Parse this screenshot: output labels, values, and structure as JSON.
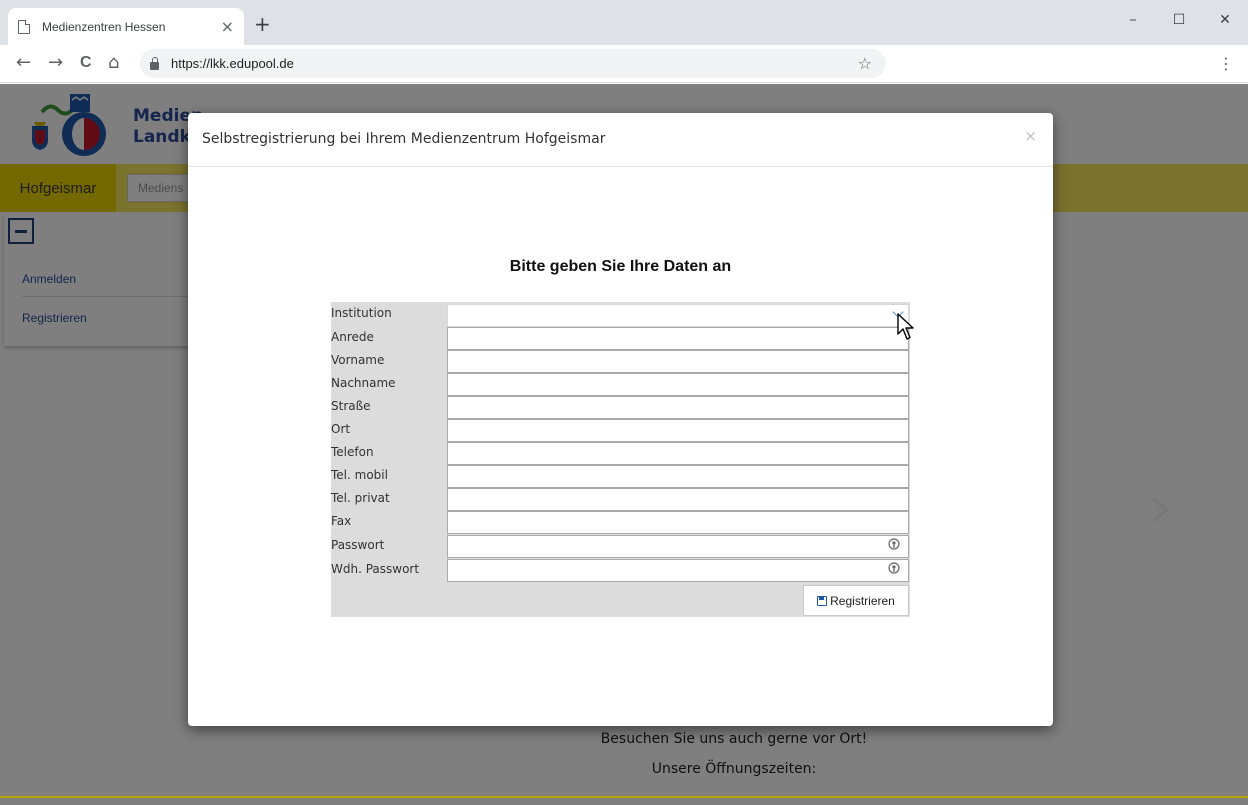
{
  "browser": {
    "tab_title": "Medienzentren Hessen",
    "tab_close": "×",
    "new_tab": "+",
    "url": "https://lkk.edupool.de",
    "nav": {
      "back": "←",
      "forward": "→",
      "reload": "C",
      "home": "⌂"
    },
    "bookmark": "☆",
    "menu": "⋮",
    "window": {
      "minimize": "–",
      "maximize": "☐",
      "close": "✕"
    }
  },
  "site": {
    "title_line1": "Medien",
    "title_line2": "Landkr",
    "location": "Hofgeismar",
    "search_placeholder": "Mediens",
    "side_menu": [
      {
        "label": "Anmelden"
      },
      {
        "label": "Registrieren"
      }
    ],
    "bg_text_1": "Besuchen Sie uns auch gerne vor Ort!",
    "bg_text_2": "Unsere Öffnungszeiten:"
  },
  "modal": {
    "title": "Selbstregistrierung bei Ihrem Medienzentrum Hofgeismar",
    "close": "×",
    "heading": "Bitte geben Sie Ihre Daten an",
    "fields": [
      {
        "label": "Institution",
        "value": ""
      },
      {
        "label": "Anrede",
        "value": ""
      },
      {
        "label": "Vorname",
        "value": ""
      },
      {
        "label": "Nachname",
        "value": ""
      },
      {
        "label": "Straße",
        "value": ""
      },
      {
        "label": "Ort",
        "value": ""
      },
      {
        "label": "Telefon",
        "value": ""
      },
      {
        "label": "Tel. mobil",
        "value": ""
      },
      {
        "label": "Tel. privat",
        "value": ""
      },
      {
        "label": "Fax",
        "value": ""
      },
      {
        "label": "Passwort",
        "value": ""
      },
      {
        "label": "Wdh. Passwort",
        "value": ""
      }
    ],
    "submit_label": "Registrieren"
  },
  "colors": {
    "yellow_bar": "#f5e65a",
    "location_tab": "#e9d100",
    "brand_blue": "#2a4b9b",
    "form_bg": "#dcdcdc"
  }
}
